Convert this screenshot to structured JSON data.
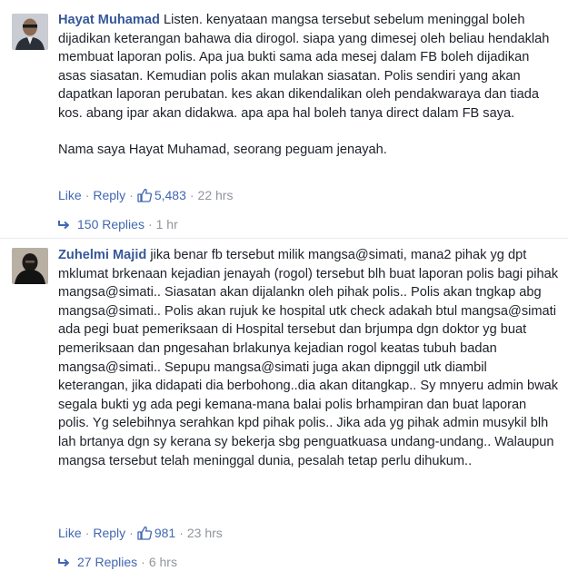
{
  "comments": [
    {
      "author": "Hayat Muhamad",
      "text": "Listen. kenyataan mangsa tersebut sebelum meninggal boleh dijadikan keterangan bahawa dia dirogol. siapa yang dimesej oleh beliau hendaklah membuat laporan polis. Apa jua bukti sama ada mesej dalam FB boleh dijadikan asas siasatan. Kemudian polis akan mulakan siasatan. Polis sendiri yang akan dapatkan laporan perubatan. kes akan dikendalikan oleh pendakwaraya dan tiada kos. abang ipar akan didakwa. apa apa hal boleh tanya direct dalam FB saya.",
      "text2": "Nama saya Hayat Muhamad, seorang peguam jenayah.",
      "like_label": "Like",
      "reply_label": "Reply",
      "likes": "5,483",
      "time": "22 hrs",
      "replies_label": "150 Replies",
      "replies_time": "1 hr"
    },
    {
      "author": "Zuhelmi Majid",
      "text": "jika benar fb tersebut milik mangsa@simati, mana2 pihak yg dpt mklumat brkenaan kejadian jenayah (rogol) tersebut blh buat laporan polis bagi pihak mangsa@simati.. Siasatan akan dijalankn oleh pihak polis.. Polis akan tngkap abg mangsa@simati.. Polis akan rujuk ke hospital utk check adakah btul mangsa@simati ada pegi buat pemeriksaan di Hospital tersebut dan brjumpa dgn doktor yg buat pemeriksaan dan pngesahan brlakunya kejadian rogol keatas tubuh badan mangsa@simati.. Sepupu mangsa@simati juga akan dipnggil utk diambil",
      "text2": "keterangan, jika didapati dia berbohong..dia akan ditangkap.. Sy mnyeru admin bwak segala bukti yg ada pegi kemana-mana balai polis brhampiran dan buat laporan polis. Yg selebihnya serahkan kpd pihak polis.. Jika ada yg pihak admin musykil blh lah brtanya dgn sy kerana sy bekerja sbg penguatkuasa undang-undang.. Walaupun mangsa tersebut telah meninggal dunia, pesalah tetap perlu dihukum..",
      "like_label": "Like",
      "reply_label": "Reply",
      "likes": "981",
      "time": "23 hrs",
      "replies_label": "27 Replies",
      "replies_time": "6 hrs"
    }
  ],
  "colors": {
    "link": "#365899",
    "action": "#4267b2",
    "meta": "#90949c",
    "text": "#1d2129"
  },
  "icons": [
    "like-thumb-icon",
    "reply-arrow-icon"
  ]
}
